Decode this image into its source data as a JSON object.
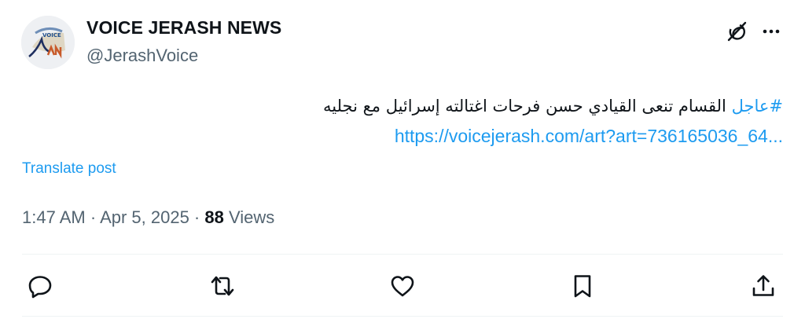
{
  "author": {
    "display_name": "VOICE JERASH NEWS",
    "handle": "@JerashVoice",
    "avatar_icon": "voice-jerash-logo"
  },
  "header_icons": [
    "grok-icon",
    "more-icon"
  ],
  "tweet": {
    "hashtag": "#عاجل",
    "text": "القسام تنعى القيادي حسن فرحات اغتالته إسرائيل مع نجليه",
    "link": "https://voicejerash.com/art?art=736165036_64..."
  },
  "translate_label": "Translate post",
  "meta": {
    "time": "1:47 AM",
    "sep1": " · ",
    "date": "Apr 5, 2025",
    "sep2": " · ",
    "views_count": "88",
    "views_label": " Views"
  },
  "actions": [
    "reply-icon",
    "repost-icon",
    "like-icon",
    "bookmark-icon",
    "share-icon"
  ],
  "colors": {
    "accent": "#1d9bf0",
    "text": "#0f1419",
    "secondary": "#536471",
    "divider": "#eff3f4"
  }
}
